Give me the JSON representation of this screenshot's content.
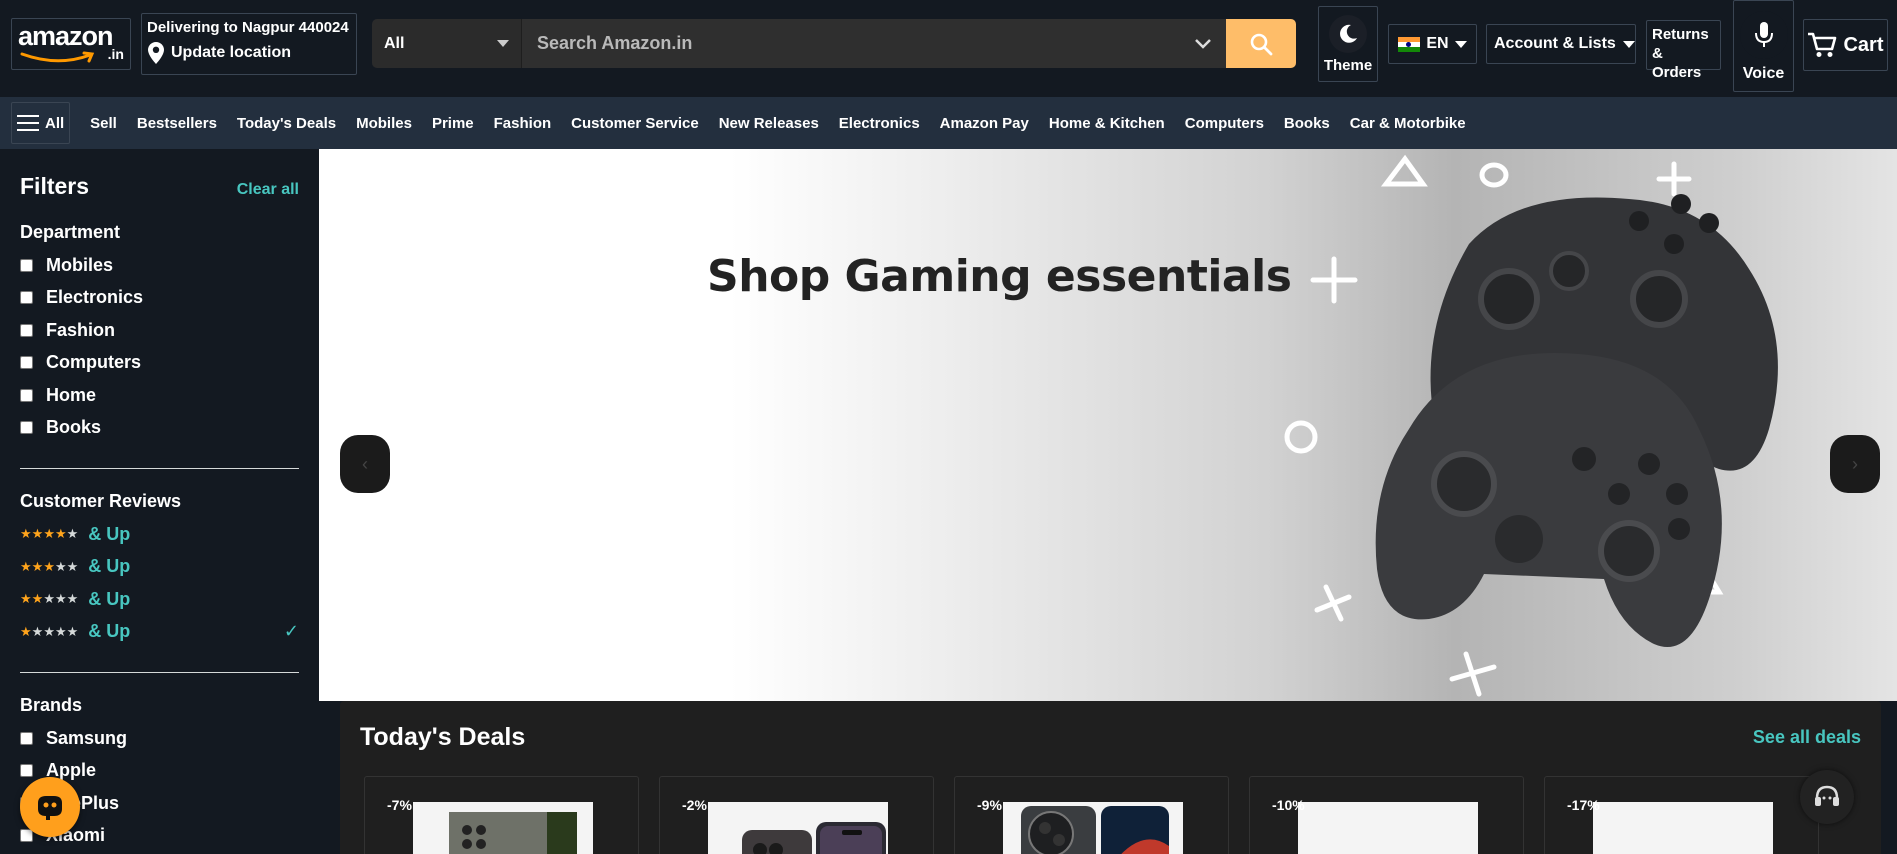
{
  "header": {
    "logo": {
      "word": "amazon",
      "suffix": ".in"
    },
    "delivery": {
      "line1": "Delivering to Nagpur 440024",
      "line2": "Update location"
    },
    "search": {
      "category": "All",
      "placeholder": "Search Amazon.in"
    },
    "theme_label": "Theme",
    "language": "EN",
    "account_label": "Account & Lists",
    "returns_line1": "Returns",
    "returns_line2": "& Orders",
    "voice_label": "Voice",
    "cart_label": "Cart"
  },
  "nav": {
    "all_label": "All",
    "links": [
      "Sell",
      "Bestsellers",
      "Today's Deals",
      "Mobiles",
      "Prime",
      "Fashion",
      "Customer Service",
      "New Releases",
      "Electronics",
      "Amazon Pay",
      "Home & Kitchen",
      "Computers",
      "Books",
      "Car & Motorbike"
    ]
  },
  "sidebar": {
    "title": "Filters",
    "clear_all": "Clear all",
    "department_title": "Department",
    "departments": [
      "Mobiles",
      "Electronics",
      "Fashion",
      "Computers",
      "Home",
      "Books"
    ],
    "reviews_title": "Customer Reviews",
    "reviews": [
      {
        "stars": 4,
        "label": "& Up",
        "selected": false
      },
      {
        "stars": 3,
        "label": "& Up",
        "selected": false
      },
      {
        "stars": 2,
        "label": "& Up",
        "selected": false
      },
      {
        "stars": 1,
        "label": "& Up",
        "selected": true
      }
    ],
    "brands_title": "Brands",
    "brands": [
      "Samsung",
      "Apple",
      "OnePlus",
      "Xiaomi"
    ],
    "selected_mark": "✓"
  },
  "hero": {
    "title": "Shop Gaming essentials",
    "prev_icon": "‹",
    "next_icon": "›"
  },
  "deals": {
    "title": "Today's Deals",
    "see_all": "See all deals",
    "items": [
      {
        "discount": "-7%"
      },
      {
        "discount": "-2%"
      },
      {
        "discount": "-9%"
      },
      {
        "discount": "-10%"
      },
      {
        "discount": "-17%"
      }
    ]
  },
  "colors": {
    "header_bg": "#131921",
    "nav_bg": "#232f3e",
    "accent_teal": "#48c6c0",
    "search_button": "#febd69",
    "star": "#ffa41c"
  }
}
